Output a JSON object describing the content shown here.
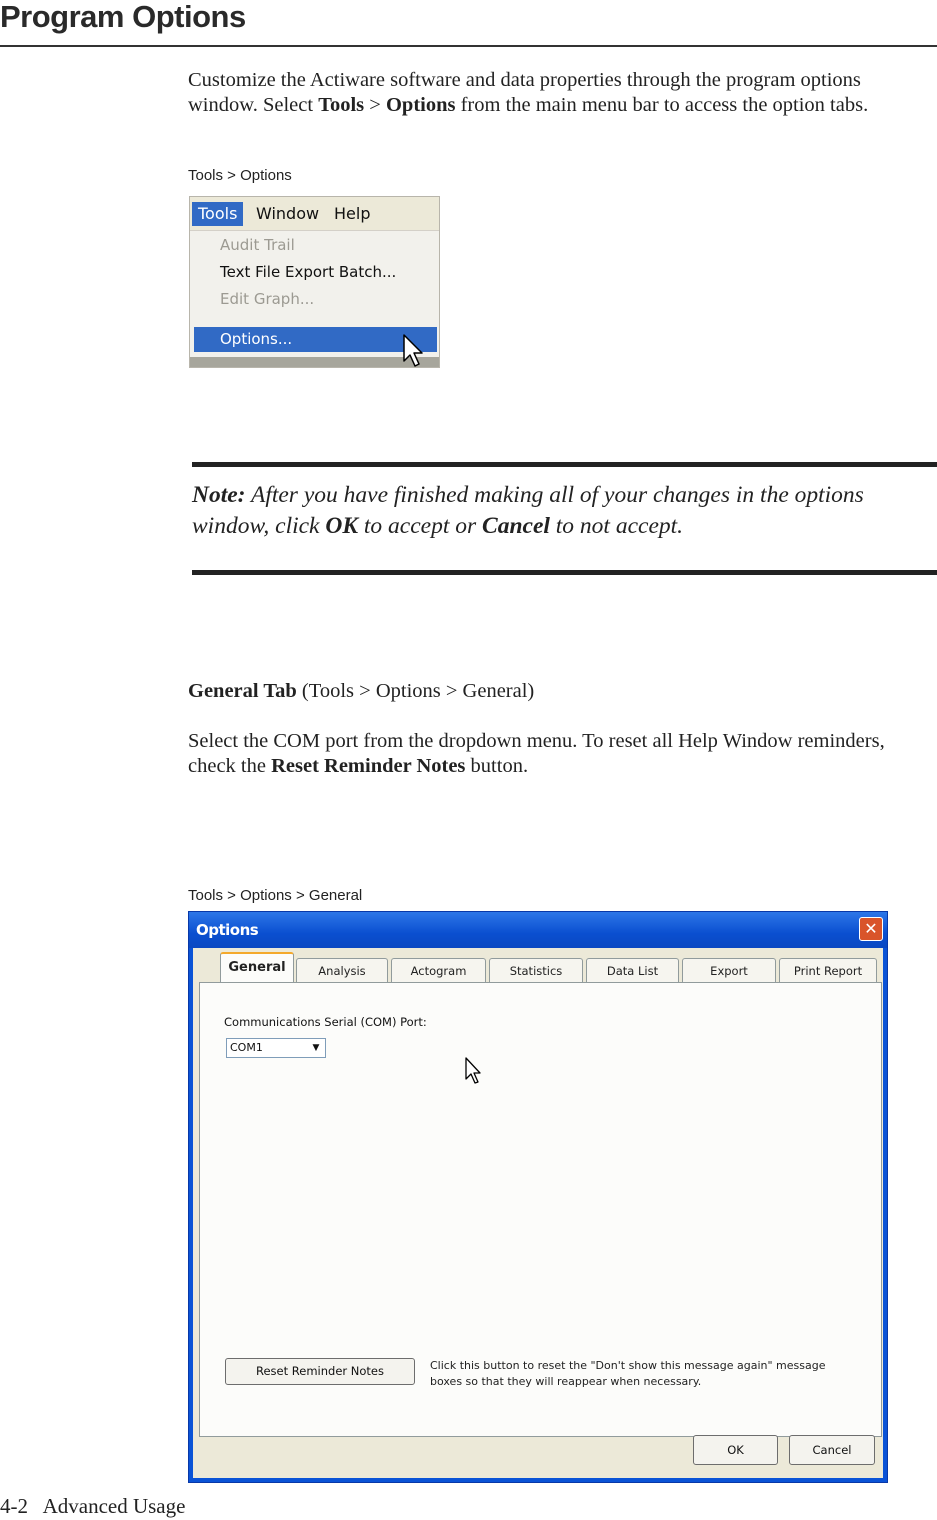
{
  "page": {
    "heading": "Program Options",
    "intro_1": "Customize the Actiware software and data properties through the program options window.  Select ",
    "intro_tools": "Tools",
    "intro_gt": " > ",
    "intro_options": "Options",
    "intro_2": " from the main menu bar to access the option tabs.",
    "caption_menu": "Tools > Options",
    "note_label": "Note:",
    "note_1": " After you have finished making all of your changes in the options window, click ",
    "note_ok": "OK",
    "note_2": " to accept or ",
    "note_cancel": "Cancel",
    "note_3": " to not accept.",
    "general_title": "General Tab",
    "general_path": " (Tools > Options > General)",
    "general_desc_1": "Select the COM port from the dropdown menu.  To reset all Help Window reminders, check the ",
    "general_desc_bold": "Reset Reminder Notes",
    "general_desc_2": " button.",
    "caption_dialog": "Tools > Options > General",
    "footer": "4-2   Advanced Usage"
  },
  "menu": {
    "bar": [
      "Tools",
      "Window",
      "Help"
    ],
    "items": [
      {
        "label": "Audit Trail",
        "disabled": true
      },
      {
        "label": "Text File Export Batch...",
        "disabled": false
      },
      {
        "label": "Edit Graph...",
        "disabled": true
      },
      {
        "label": "Options...",
        "disabled": false,
        "highlighted": true
      }
    ]
  },
  "dialog": {
    "title": "Options",
    "close_glyph": "✕",
    "tabs": [
      "General",
      "Analysis",
      "Actogram",
      "Statistics",
      "Data List",
      "Export",
      "Print Report"
    ],
    "com_label": "Communications Serial (COM) Port:",
    "com_value": "COM1",
    "reset_button": "Reset Reminder Notes",
    "reset_description": "Click this button to reset the \"Don't show this message again\" message boxes so that they will reappear when necessary.",
    "ok_button": "OK",
    "cancel_button": "Cancel"
  },
  "colors": {
    "menu_highlight": "#316ac5",
    "titlebar": "#0a53d6",
    "active_tab_accent": "#f4a92b"
  }
}
